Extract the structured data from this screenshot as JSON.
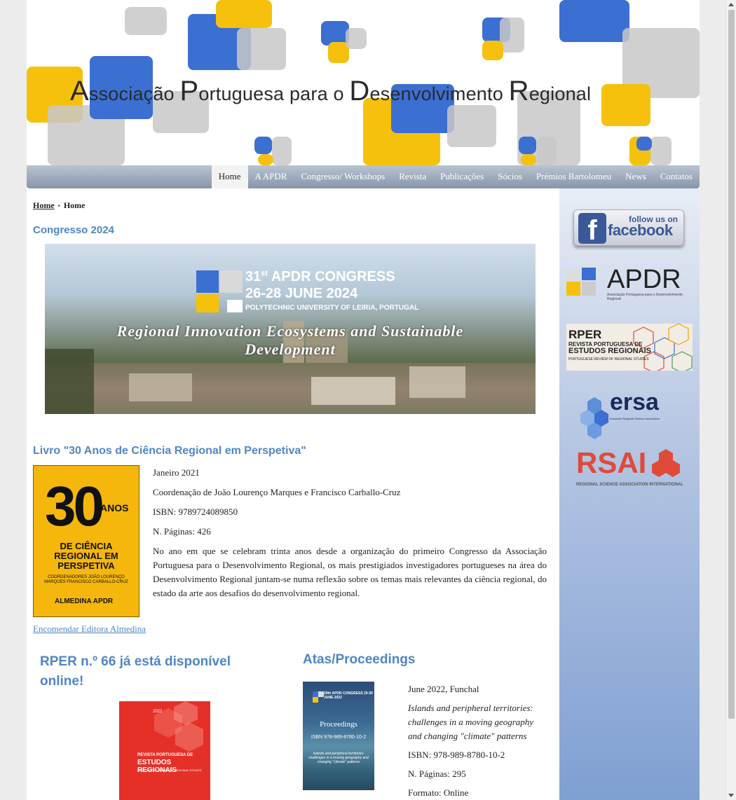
{
  "site": {
    "banner_title_parts": [
      "A",
      "ssociação ",
      "P",
      "ortuguesa para o ",
      "D",
      "esenvolvimento ",
      "R",
      "egional"
    ]
  },
  "nav": {
    "items": [
      "Home",
      "A APDR",
      "Congresso/ Workshops",
      "Revista",
      "Publicações",
      "Sócios",
      "Prémios Bartolomeu",
      "News",
      "Contatos"
    ],
    "active": "Home"
  },
  "breadcrumb": {
    "link": "Home",
    "separator": "•",
    "current": "Home"
  },
  "congresso": {
    "heading": "Congresso 2024",
    "image": {
      "line1_prefix": "31",
      "line1_sup": "st",
      "line1_rest": " APDR CONGRESS",
      "line2": "26-28 JUNE 2024",
      "line3": "POLYTECHNIC UNIVERSITY OF LEIRIA, PORTUGAL",
      "slogan1": "Regional Innovation Ecosystems and Sustainable",
      "slogan2": "Development"
    }
  },
  "livro": {
    "heading": "Livro \"30 Anos de Ciência Regional em Perspetiva\"",
    "cover": {
      "number": "30",
      "anos": "ANOS",
      "subtitle": "DE CIÊNCIA REGIONAL EM PERSPETIVA",
      "coordinators": "COORDENADORES JOÃO LOURENÇO MARQUES FRANCISCO CARBALLO-CRUZ",
      "publisher": "ALMEDINA  APDR"
    },
    "date": "Janeiro 2021",
    "coordination": "Coordenação de João Lourenço Marques e Francisco Carballo-Cruz",
    "isbn": "ISBN: 9789724089850",
    "pages": "N. Páginas: 426",
    "description": "No ano em que se celebram trinta anos desde a organização do primeiro Congresso da Associação Portuguesa para o Desenvolvimento Regional, os mais prestigiados investigadores portugueses na área do Desenvolvimento Regional juntam-se numa reflexão sobre os temas mais relevantes da ciência regional, do estado da arte aos desafios do desenvolvimento regional.",
    "order_link": "Encomendar Editora Almedina"
  },
  "rper": {
    "heading": "RPER n.º 66 já está disponível online!",
    "cover": {
      "year": "2022",
      "line1": "REVISTA PORTUGUESA DE",
      "line2": "ESTUDOS REGIONAIS",
      "line3": "PORTUGUESE REVIEW OF REGIONAL STUDIES"
    }
  },
  "atas": {
    "heading": "Atas/Proceedings",
    "cover": {
      "congress": "29th APDR CONGRESS 29-30 JUNE 2022",
      "title": "Proceedings",
      "isbn": "ISBN 978-989-8780-10-2",
      "subtitle": "Islands and peripheral territories: challenges in a moving geography and changing \"climate\" patterns"
    },
    "date": "June 2022, Funchal",
    "title": "Islands and peripheral territories: challenges in a moving geography and changing \"climate\" patterns",
    "isbn": "ISBN: 978-989-8780-10-2",
    "pages": "N. Páginas: 295",
    "format": "Formato: Online"
  },
  "sidebar": {
    "facebook_line1": "follow us on",
    "facebook_line2": "facebook",
    "facebook_f": "f",
    "apdr_text": "APDR",
    "apdr_sub": "Associação Portuguesa para o Desenvolvimento Regional",
    "rper_r1": "RPER",
    "rper_r2": "REVISTA PORTUGUESA DE",
    "rper_r3": "ESTUDOS REGIONAIS",
    "rper_r4": "PORTUGUESE REVIEW OF REGIONAL STUDIES",
    "ersa_text": "ersa",
    "ersa_sub": "European Regional Science Association",
    "rsai_text": "RSAI",
    "rsai_sub": "REGIONAL SCIENCE ASSOCIATION INTERNATIONAL"
  },
  "colors": {
    "blue": "#3b6fd1",
    "yellow": "#f5c10c",
    "gray": "#c8c8c8",
    "heading": "#4f86c6"
  }
}
